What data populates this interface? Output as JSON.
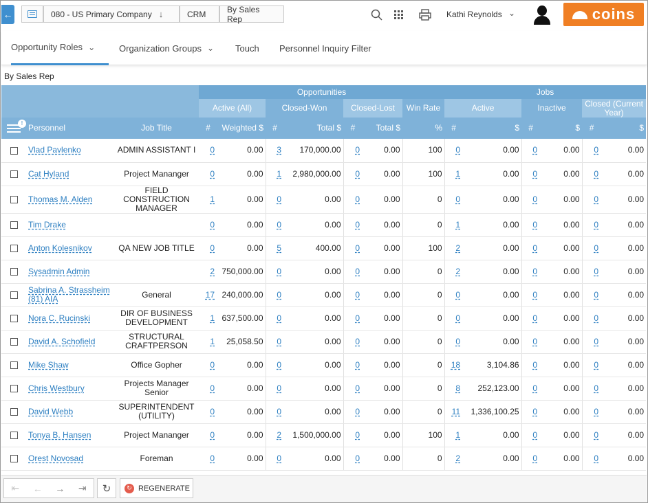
{
  "breadcrumbs": {
    "company": "080 - US Primary Company",
    "module": "CRM",
    "page": "By Sales Rep"
  },
  "user": {
    "name": "Kathi Reynolds"
  },
  "logo_text": "coins",
  "tabs": [
    {
      "label": "Opportunity Roles"
    },
    {
      "label": "Organization Groups"
    },
    {
      "label": "Touch"
    },
    {
      "label": "Personnel Inquiry Filter"
    }
  ],
  "section_title": "By Sales Rep",
  "table": {
    "group_headers": {
      "opportunities": "Opportunities",
      "jobs": "Jobs"
    },
    "sub_headers": {
      "active_all": "Active (All)",
      "closed_won": "Closed-Won",
      "closed_lost": "Closed-Lost",
      "win_rate": "Win Rate",
      "active": "Active",
      "inactive": "Inactive",
      "closed_current_year": "Closed (Current Year)"
    },
    "columns": {
      "personnel": "Personnel",
      "job_title": "Job Title",
      "count": "#",
      "weighted": "Weighted $",
      "total": "Total $",
      "percent": "%",
      "dollar": "$"
    },
    "badge": "!",
    "rows": [
      {
        "name": "Vlad Pavlenko",
        "title": "ADMIN ASSISTANT I",
        "aa_n": "0",
        "aa_w": "0.00",
        "cw_n": "3",
        "cw_t": "170,000.00",
        "cl_n": "0",
        "cl_t": "0.00",
        "wr": "100",
        "ja_n": "0",
        "ja_v": "0.00",
        "ji_n": "0",
        "ji_v": "0.00",
        "jc_n": "0",
        "jc_v": "0.00"
      },
      {
        "name": "Cat Hyland",
        "title": "Project Mananger",
        "aa_n": "0",
        "aa_w": "0.00",
        "cw_n": "1",
        "cw_t": "2,980,000.00",
        "cl_n": "0",
        "cl_t": "0.00",
        "wr": "100",
        "ja_n": "1",
        "ja_v": "0.00",
        "ji_n": "0",
        "ji_v": "0.00",
        "jc_n": "0",
        "jc_v": "0.00"
      },
      {
        "name": "Thomas M. Alden",
        "title": "FIELD CONSTRUCTION MANAGER",
        "aa_n": "1",
        "aa_w": "0.00",
        "cw_n": "0",
        "cw_t": "0.00",
        "cl_n": "0",
        "cl_t": "0.00",
        "wr": "0",
        "ja_n": "0",
        "ja_v": "0.00",
        "ji_n": "0",
        "ji_v": "0.00",
        "jc_n": "0",
        "jc_v": "0.00"
      },
      {
        "name": "Tim Drake",
        "title": "",
        "aa_n": "0",
        "aa_w": "0.00",
        "cw_n": "0",
        "cw_t": "0.00",
        "cl_n": "0",
        "cl_t": "0.00",
        "wr": "0",
        "ja_n": "1",
        "ja_v": "0.00",
        "ji_n": "0",
        "ji_v": "0.00",
        "jc_n": "0",
        "jc_v": "0.00"
      },
      {
        "name": "Anton Kolesnikov",
        "title": "QA NEW JOB TITLE",
        "aa_n": "0",
        "aa_w": "0.00",
        "cw_n": "5",
        "cw_t": "400.00",
        "cl_n": "0",
        "cl_t": "0.00",
        "wr": "100",
        "ja_n": "2",
        "ja_v": "0.00",
        "ji_n": "0",
        "ji_v": "0.00",
        "jc_n": "0",
        "jc_v": "0.00"
      },
      {
        "name": "Sysadmin Admin",
        "title": "",
        "aa_n": "2",
        "aa_w": "750,000.00",
        "cw_n": "0",
        "cw_t": "0.00",
        "cl_n": "0",
        "cl_t": "0.00",
        "wr": "0",
        "ja_n": "2",
        "ja_v": "0.00",
        "ji_n": "0",
        "ji_v": "0.00",
        "jc_n": "0",
        "jc_v": "0.00"
      },
      {
        "name": "Sabrina A. Strassheim (81) AIA",
        "title": "General",
        "aa_n": "17",
        "aa_w": "240,000.00",
        "cw_n": "0",
        "cw_t": "0.00",
        "cl_n": "0",
        "cl_t": "0.00",
        "wr": "0",
        "ja_n": "0",
        "ja_v": "0.00",
        "ji_n": "0",
        "ji_v": "0.00",
        "jc_n": "0",
        "jc_v": "0.00"
      },
      {
        "name": "Nora C. Rucinski",
        "title": "DIR OF BUSINESS DEVELOPMENT",
        "aa_n": "1",
        "aa_w": "637,500.00",
        "cw_n": "0",
        "cw_t": "0.00",
        "cl_n": "0",
        "cl_t": "0.00",
        "wr": "0",
        "ja_n": "0",
        "ja_v": "0.00",
        "ji_n": "0",
        "ji_v": "0.00",
        "jc_n": "0",
        "jc_v": "0.00"
      },
      {
        "name": "David A. Schofield",
        "title": "STRUCTURAL CRAFTPERSON",
        "aa_n": "1",
        "aa_w": "25,058.50",
        "cw_n": "0",
        "cw_t": "0.00",
        "cl_n": "0",
        "cl_t": "0.00",
        "wr": "0",
        "ja_n": "0",
        "ja_v": "0.00",
        "ji_n": "0",
        "ji_v": "0.00",
        "jc_n": "0",
        "jc_v": "0.00"
      },
      {
        "name": "Mike Shaw",
        "title": "Office Gopher",
        "aa_n": "0",
        "aa_w": "0.00",
        "cw_n": "0",
        "cw_t": "0.00",
        "cl_n": "0",
        "cl_t": "0.00",
        "wr": "0",
        "ja_n": "18",
        "ja_v": "3,104.86",
        "ji_n": "0",
        "ji_v": "0.00",
        "jc_n": "0",
        "jc_v": "0.00"
      },
      {
        "name": "Chris Westbury",
        "title": "Projects Manager Senior",
        "aa_n": "0",
        "aa_w": "0.00",
        "cw_n": "0",
        "cw_t": "0.00",
        "cl_n": "0",
        "cl_t": "0.00",
        "wr": "0",
        "ja_n": "8",
        "ja_v": "252,123.00",
        "ji_n": "0",
        "ji_v": "0.00",
        "jc_n": "0",
        "jc_v": "0.00"
      },
      {
        "name": "David Webb",
        "title": "SUPERINTENDENT (UTILITY)",
        "aa_n": "0",
        "aa_w": "0.00",
        "cw_n": "0",
        "cw_t": "0.00",
        "cl_n": "0",
        "cl_t": "0.00",
        "wr": "0",
        "ja_n": "11",
        "ja_v": "1,336,100.25",
        "ji_n": "0",
        "ji_v": "0.00",
        "jc_n": "0",
        "jc_v": "0.00"
      },
      {
        "name": "Tonya B. Hansen",
        "title": "Project Mananger",
        "aa_n": "0",
        "aa_w": "0.00",
        "cw_n": "2",
        "cw_t": "1,500,000.00",
        "cl_n": "0",
        "cl_t": "0.00",
        "wr": "100",
        "ja_n": "1",
        "ja_v": "0.00",
        "ji_n": "0",
        "ji_v": "0.00",
        "jc_n": "0",
        "jc_v": "0.00"
      },
      {
        "name": "Orest Novosad",
        "title": "Foreman",
        "aa_n": "0",
        "aa_w": "0.00",
        "cw_n": "0",
        "cw_t": "0.00",
        "cl_n": "0",
        "cl_t": "0.00",
        "wr": "0",
        "ja_n": "2",
        "ja_v": "0.00",
        "ji_n": "0",
        "ji_v": "0.00",
        "jc_n": "0",
        "jc_v": "0.00"
      }
    ]
  },
  "toolbar": {
    "regenerate_label": "REGENERATE"
  },
  "icons": [
    "back-arrow-icon",
    "list-icon",
    "search-icon",
    "apps-grid-icon",
    "print-icon",
    "user-avatar-icon",
    "first-page-icon",
    "prev-page-icon",
    "next-page-icon",
    "last-page-icon",
    "refresh-icon",
    "regenerate-icon"
  ],
  "colors": {
    "accent": "#3f8fcf",
    "header_bg": "#8ab9dc",
    "link": "#2d7fc1",
    "logo_bg": "#f07f24"
  }
}
